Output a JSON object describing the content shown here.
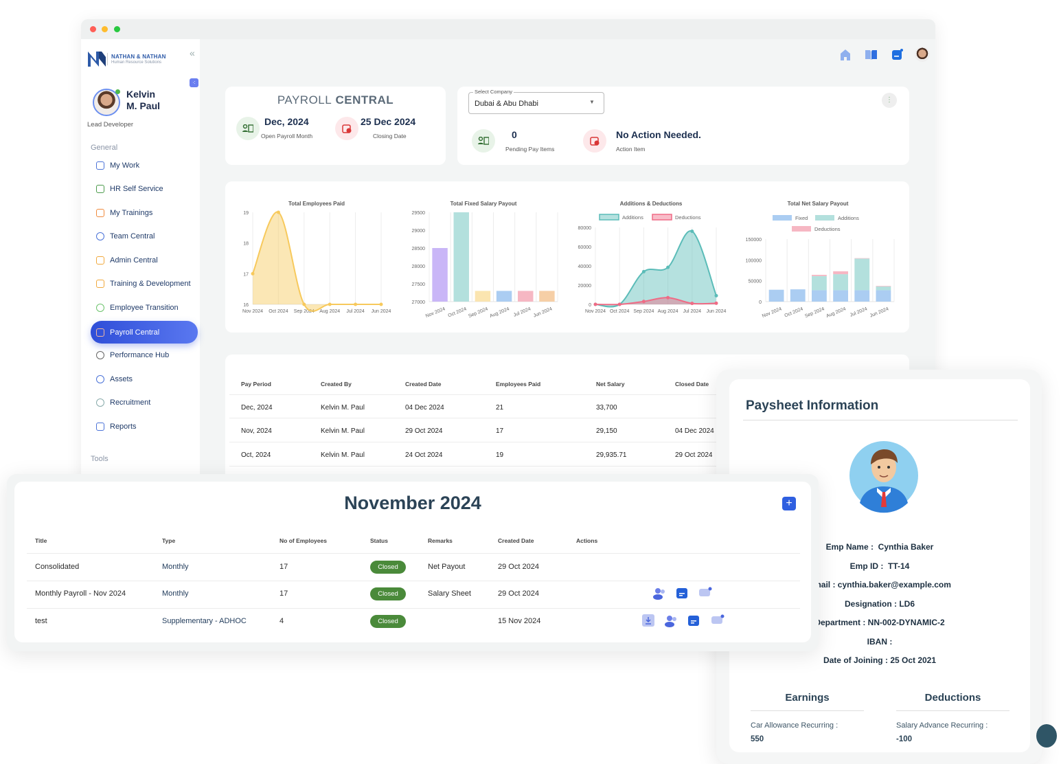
{
  "brand": {
    "name": "NATHAN & NATHAN",
    "tagline": "Human Resource Solutions"
  },
  "user": {
    "first": "Kelvin",
    "last": "M. Paul",
    "role": "Lead Developer"
  },
  "sidebar": {
    "section_general": "General",
    "section_tools": "Tools",
    "items": [
      {
        "label": "My Work",
        "icon": "checklist-icon"
      },
      {
        "label": "HR Self Service",
        "icon": "id-card-icon"
      },
      {
        "label": "My Trainings",
        "icon": "document-icon"
      },
      {
        "label": "Team Central",
        "icon": "team-icon"
      },
      {
        "label": "Admin Central",
        "icon": "building-icon"
      },
      {
        "label": "Training & Development",
        "icon": "grid-icon"
      },
      {
        "label": "Employee Transition",
        "icon": "heart-icon"
      },
      {
        "label": "Payroll Central",
        "icon": "payroll-icon",
        "active": true
      },
      {
        "label": "Performance Hub",
        "icon": "gauge-icon"
      },
      {
        "label": "Assets",
        "icon": "asset-icon"
      },
      {
        "label": "Recruitment",
        "icon": "person-icon"
      },
      {
        "label": "Reports",
        "icon": "report-icon"
      }
    ]
  },
  "summary": {
    "title_light": "PAYROLL",
    "title_bold": "CENTRAL",
    "open_month": "Dec, 2024",
    "open_month_label": "Open Payroll Month",
    "closing_date": "25 Dec 2024",
    "closing_label": "Closing Date"
  },
  "company": {
    "select_label": "Select Company",
    "selected": "Dubai & Abu Dhabi",
    "pending_count": "0",
    "pending_label": "Pending Pay Items",
    "action_text": "No Action Needed.",
    "action_label": "Action Item"
  },
  "colors": {
    "accent": "#3b5bdb",
    "closed": "#4a8a3a",
    "teal": "#5bbcb8",
    "pink": "#ef6b85"
  },
  "chart_data": [
    {
      "type": "area",
      "title": "Total Employees Paid",
      "categories": [
        "Nov 2024",
        "Oct 2024",
        "Sep 2024",
        "Aug 2024",
        "Jul 2024",
        "Jun 2024"
      ],
      "ylim": [
        16,
        19
      ],
      "yticks": [
        16,
        17,
        18,
        19
      ],
      "series": [
        {
          "values": [
            17,
            19,
            16,
            16,
            16,
            16
          ],
          "color": "#f7c95c"
        }
      ]
    },
    {
      "type": "bar",
      "title": "Total Fixed Salary Payout",
      "categories": [
        "Nov 2024",
        "Oct 2024",
        "Sep 2024",
        "Aug 2024",
        "Jul 2024",
        "Jun 2024"
      ],
      "ylim": [
        27000,
        29500
      ],
      "yticks": [
        27000,
        27500,
        28000,
        28500,
        29000,
        29500
      ],
      "values": [
        28500,
        29500,
        27300,
        27300,
        27300,
        27300
      ],
      "colors": [
        "#c9b6f7",
        "#b3e0dd",
        "#fbe5b0",
        "#abcdf2",
        "#f6b7c3",
        "#f6cfa6"
      ]
    },
    {
      "type": "area",
      "title": "Additions & Deductions",
      "categories": [
        "Nov 2024",
        "Oct 2024",
        "Sep 2024",
        "Aug 2024",
        "Jul 2024",
        "Jun 2024"
      ],
      "ylim": [
        0,
        80000
      ],
      "yticks": [
        0,
        20000,
        40000,
        60000,
        80000
      ],
      "legend": "top",
      "series": [
        {
          "name": "Additions",
          "values": [
            0,
            0,
            34000,
            38500,
            76000,
            9000
          ],
          "color": "#5bbcb8"
        },
        {
          "name": "Deductions",
          "values": [
            0,
            0,
            3000,
            7000,
            1000,
            1200
          ],
          "color": "#ef6b85"
        }
      ]
    },
    {
      "type": "stacked-bar",
      "title": "Total Net Salary Payout",
      "categories": [
        "Nov 2024",
        "Oct 2024",
        "Sep 2024",
        "Aug 2024",
        "Jul 2024",
        "Jun 2024"
      ],
      "ylim": [
        0,
        150000
      ],
      "yticks": [
        0,
        50000,
        100000,
        150000
      ],
      "legend": "top",
      "series": [
        {
          "name": "Fixed",
          "values": [
            28500,
            29500,
            27300,
            27300,
            27300,
            27300
          ],
          "color": "#abcdf2"
        },
        {
          "name": "Additions",
          "values": [
            0,
            0,
            34000,
            38500,
            76000,
            9000
          ],
          "color": "#b3e0dd"
        },
        {
          "name": "Deductions",
          "values": [
            0,
            0,
            3000,
            7000,
            1000,
            1200
          ],
          "color": "#f6b7c3"
        }
      ]
    }
  ],
  "history": {
    "headers": [
      "Pay Period",
      "Created By",
      "Created Date",
      "Employees Paid",
      "Net Salary",
      "Closed Date"
    ],
    "rows": [
      [
        "Dec, 2024",
        "Kelvin M. Paul",
        "04 Dec 2024",
        "21",
        "33,700",
        ""
      ],
      [
        "Nov, 2024",
        "Kelvin M. Paul",
        "29 Oct 2024",
        "17",
        "29,150",
        "04 Dec 2024"
      ],
      [
        "Oct, 2024",
        "Kelvin M. Paul",
        "24 Oct 2024",
        "19",
        "29,935.71",
        "29 Oct 2024"
      ]
    ]
  },
  "november": {
    "title": "November 2024",
    "headers": [
      "Title",
      "Type",
      "No of Employees",
      "Status",
      "Remarks",
      "Created Date",
      "Actions"
    ],
    "rows": [
      [
        "Consolidated",
        "Monthly",
        "17",
        "Closed",
        "Net Payout",
        "29 Oct 2024"
      ],
      [
        "Monthly Payroll - Nov 2024",
        "Monthly",
        "17",
        "Closed",
        "Salary Sheet",
        "29 Oct 2024"
      ],
      [
        "test",
        "Supplementary - ADHOC",
        "4",
        "Closed",
        "",
        "15 Nov 2024"
      ]
    ]
  },
  "paysheet": {
    "title": "Paysheet Information",
    "fields": [
      {
        "label": "Emp Name :",
        "value": "Cynthia Baker"
      },
      {
        "label": "Emp ID :",
        "value": "TT-14"
      },
      {
        "label": "Email :",
        "value": "cynthia.baker@example.com"
      },
      {
        "label": "Designation :",
        "value": "LD6"
      },
      {
        "label": "Department :",
        "value": "NN-002-DYNAMIC-2"
      },
      {
        "label": "IBAN :",
        "value": ""
      },
      {
        "label": "Date of Joining :",
        "value": "25 Oct 2021"
      }
    ],
    "earnings_title": "Earnings",
    "deductions_title": "Deductions",
    "earning_label": "Car Allowance Recurring :",
    "earning_value": "550",
    "deduction_label": "Salary Advance Recurring :",
    "deduction_value": "-100"
  }
}
